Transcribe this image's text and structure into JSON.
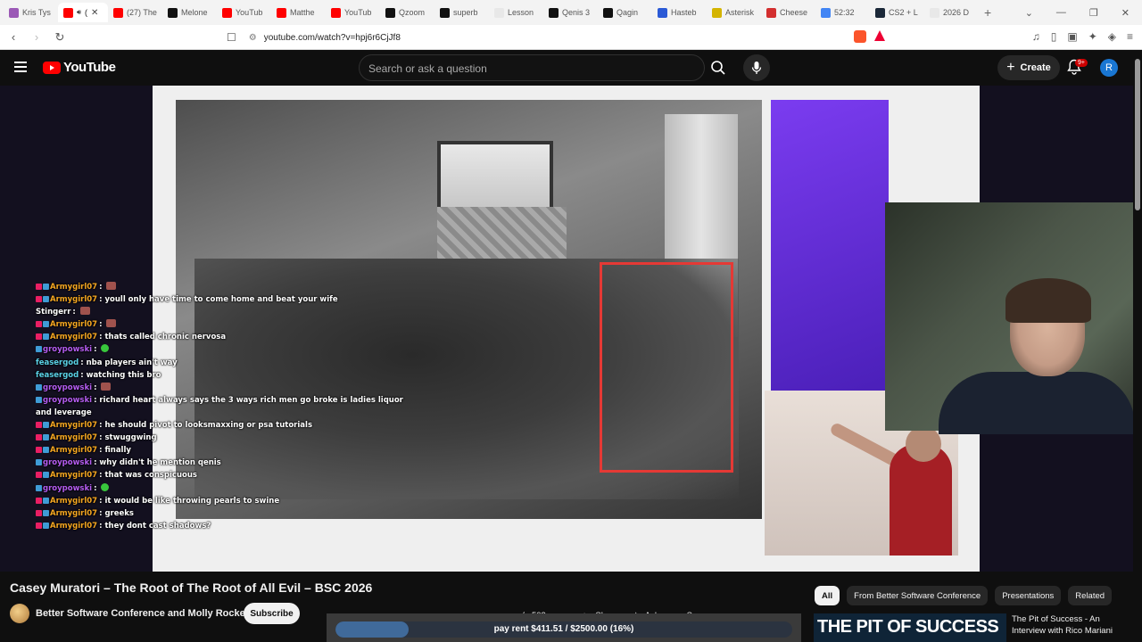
{
  "browser": {
    "tabs": [
      {
        "label": "Kris Tys",
        "color": "#9b59b6"
      },
      {
        "label": "(",
        "color": "#f00",
        "active": true
      },
      {
        "label": "(27) The",
        "color": "#f00"
      },
      {
        "label": "Melone",
        "color": "#111"
      },
      {
        "label": "YouTub",
        "color": "#f00"
      },
      {
        "label": "Matthe",
        "color": "#f00"
      },
      {
        "label": "YouTub",
        "color": "#f00"
      },
      {
        "label": "Qzoom",
        "color": "#111"
      },
      {
        "label": "superb",
        "color": "#111"
      },
      {
        "label": "Lesson",
        "color": "#e8e8e8"
      },
      {
        "label": "Qenis 3",
        "color": "#111"
      },
      {
        "label": "Qagin",
        "color": "#111"
      },
      {
        "label": "Hasteb",
        "color": "#2b5ad6"
      },
      {
        "label": "Asterisk",
        "color": "#d4b400"
      },
      {
        "label": "Cheese",
        "color": "#d32f2f"
      },
      {
        "label": "52:32",
        "color": "#4285f4"
      },
      {
        "label": "CS2 + L",
        "color": "#1b2838"
      },
      {
        "label": "2026 D",
        "color": "#e8e8e8"
      }
    ],
    "new_tab": "+",
    "url": "youtube.com/watch?v=hpj6r6CjJf8",
    "window_controls": [
      "⌄",
      "—",
      "❐",
      "✕"
    ]
  },
  "header": {
    "logo_text": "YouTube",
    "search_placeholder": "Search or ask a question",
    "create_label": "Create",
    "notif_badge": "9+",
    "avatar_letter": "R"
  },
  "chat": [
    {
      "name": "Armygirl07",
      "msg": "",
      "color": "#f4a621",
      "badges": [
        "#e91e63",
        "#3f9cd6"
      ],
      "emote": "red"
    },
    {
      "name": "Armygirl07",
      "msg": "youll only have time to come home and beat your wife",
      "color": "#f4a621",
      "badges": [
        "#e91e63",
        "#3f9cd6"
      ]
    },
    {
      "name": "Stingerr",
      "msg": "",
      "color": "#ffffff",
      "badges": [],
      "emote": "red"
    },
    {
      "name": "Armygirl07",
      "msg": "",
      "color": "#f4a621",
      "badges": [
        "#e91e63",
        "#3f9cd6"
      ],
      "emote": "red"
    },
    {
      "name": "Armygirl07",
      "msg": "thats called chronic nervosa",
      "color": "#f4a621",
      "badges": [
        "#e91e63",
        "#3f9cd6"
      ]
    },
    {
      "name": "groypowski",
      "msg": "",
      "color": "#b45cf0",
      "badges": [
        "#3f9cd6"
      ],
      "emote": "green"
    },
    {
      "name": "feasergod",
      "msg": "nba players ain't way",
      "color": "#5ad1e6",
      "badges": []
    },
    {
      "name": "feasergod",
      "msg": "watching this bro",
      "color": "#5ad1e6",
      "badges": []
    },
    {
      "name": "groypowski",
      "msg": "",
      "color": "#b45cf0",
      "badges": [
        "#3f9cd6"
      ],
      "emote": "red"
    },
    {
      "name": "groypowski",
      "msg": "richard heart always says the 3 ways rich men go broke is ladies liquor and leverage",
      "color": "#b45cf0",
      "badges": [
        "#3f9cd6"
      ]
    },
    {
      "name": "Armygirl07",
      "msg": "he should pivot to looksmaxxing or psa tutorials",
      "color": "#f4a621",
      "badges": [
        "#e91e63",
        "#3f9cd6"
      ]
    },
    {
      "name": "Armygirl07",
      "msg": "stwuggwing",
      "color": "#f4a621",
      "badges": [
        "#e91e63",
        "#3f9cd6"
      ]
    },
    {
      "name": "Armygirl07",
      "msg": "finally",
      "color": "#f4a621",
      "badges": [
        "#e91e63",
        "#3f9cd6"
      ]
    },
    {
      "name": "groypowski",
      "msg": "why didn't he mention qenis",
      "color": "#b45cf0",
      "badges": [
        "#3f9cd6"
      ]
    },
    {
      "name": "Armygirl07",
      "msg": "that was conspicuous",
      "color": "#f4a621",
      "badges": [
        "#e91e63",
        "#3f9cd6"
      ]
    },
    {
      "name": "groypowski",
      "msg": "",
      "color": "#b45cf0",
      "badges": [
        "#3f9cd6"
      ],
      "emote": "green"
    },
    {
      "name": "Armygirl07",
      "msg": "it would be like throwing pearls to swine",
      "color": "#f4a621",
      "badges": [
        "#e91e63",
        "#3f9cd6"
      ]
    },
    {
      "name": "Armygirl07",
      "msg": "greeks",
      "color": "#f4a621",
      "badges": [
        "#e91e63",
        "#3f9cd6"
      ]
    },
    {
      "name": "Armygirl07",
      "msg": "they dont cast shadows?",
      "color": "#f4a621",
      "badges": [
        "#e91e63",
        "#3f9cd6"
      ]
    }
  ],
  "video": {
    "title": "Casey Muratori – The Root of The Root of All Evil – BSC 2026",
    "channel": "Better Software Conference and Molly Rocket",
    "subscribe": "Subscribe",
    "likes": "503",
    "share": "Share",
    "ask": "Ask",
    "save": "Save",
    "more": "•••"
  },
  "donation": {
    "text": "pay rent $411.51 / $2500.00 (16%)",
    "progress": 0.16
  },
  "sidebar": {
    "chips": [
      "All",
      "From Better Software Conference",
      "Presentations",
      "Related"
    ],
    "rec_thumb_text": "THE PIT OF SUCCESS",
    "rec_title": "The Pit of Success - An Interview with Rico Mariani"
  }
}
